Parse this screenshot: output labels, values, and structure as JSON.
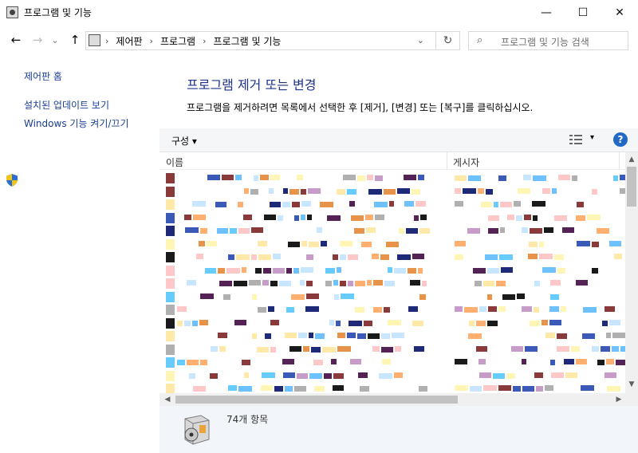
{
  "window": {
    "title": "프로그램 및 기능"
  },
  "titlebar": {
    "minimize": "—",
    "maximize": "☐",
    "close": "✕"
  },
  "nav": {
    "back": "←",
    "forward": "→",
    "recent": "⌄",
    "up": "↑"
  },
  "address": {
    "crumbs": [
      "제어판",
      "프로그램",
      "프로그램 및 기능"
    ],
    "separator": "›",
    "dropdown": "⌄",
    "refresh": "↻"
  },
  "search": {
    "placeholder": "프로그램 및 기능 검색",
    "icon": "⌕"
  },
  "sidebar": {
    "home": "제어판 홈",
    "updates": "설치된 업데이트 보기",
    "features": "Windows 기능 켜기/끄기"
  },
  "main": {
    "heading": "프로그램 제거 또는 변경",
    "description": "프로그램을 제거하려면 목록에서 선택한 후 [제거], [변경] 또는 [복구]를 클릭하십시오."
  },
  "toolbar": {
    "organize": "구성 ▾",
    "view_dropdown": "▾",
    "help": "?"
  },
  "columns": {
    "name": "이름",
    "publisher": "게시자"
  },
  "scroll": {
    "up": "▲",
    "down": "▼",
    "left": "◀",
    "right": "▶"
  },
  "status": {
    "count": "74개 항목"
  },
  "colors": {
    "link": "#1a3e94",
    "heading": "#1e3287",
    "toolbar_bg": "#f5f6f7",
    "status_bg": "#f2f6fb",
    "help": "#2169c4",
    "pixel_palette": [
      "#ffc8c8",
      "#c8e6ff",
      "#fff5b4",
      "#552255",
      "#3b5ab8",
      "#1e2a78",
      "#e8934a",
      "#8a3a3a",
      "#6ec1ff",
      "#b0b0b0",
      "#1a1a1a",
      "#ffb070",
      "#66ccff",
      "#ffe9a8",
      "#c89cc8"
    ]
  }
}
